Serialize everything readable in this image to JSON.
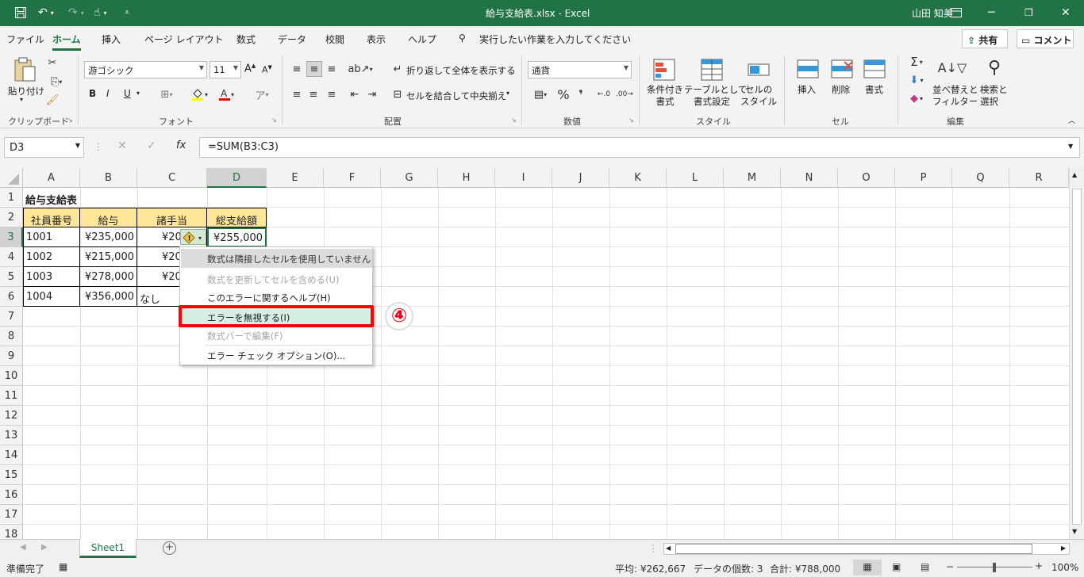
{
  "window": {
    "title": "給与支給表.xlsx  -  Excel",
    "user": "山田 知美"
  },
  "tabs": [
    "ファイル",
    "ホーム",
    "挿入",
    "ページ レイアウト",
    "数式",
    "データ",
    "校閲",
    "表示",
    "ヘルプ"
  ],
  "tell_me": "実行したい作業を入力してください",
  "share": "共有",
  "comment": "コメント",
  "ribbon": {
    "paste": "貼り付け",
    "font_name": "游ゴシック",
    "font_size": "11",
    "font_grow": "A",
    "font_shrink": "A",
    "bold": "B",
    "italic": "I",
    "underline": "U",
    "wrap_text": "折り返して全体を表示する",
    "merge_center": "セルを結合して中央揃え",
    "number_format": "通貨",
    "cond_format": [
      "条件付き",
      "書式"
    ],
    "table_format": [
      "テーブルとして",
      "書式設定"
    ],
    "cell_style": [
      "セルの",
      "スタイル"
    ],
    "insert": "挿入",
    "delete": "削除",
    "format": "書式",
    "sort_filter": [
      "並べ替えと",
      "フィルター"
    ],
    "find_select": [
      "検索と",
      "選択"
    ],
    "groups": {
      "clipboard": "クリップボード",
      "font": "フォント",
      "alignment": "配置",
      "number": "数値",
      "style": "スタイル",
      "cells": "セル",
      "editing": "編集"
    }
  },
  "formula": {
    "name_box": "D3",
    "formula": "=SUM(B3:C3)"
  },
  "columns": [
    "A",
    "B",
    "C",
    "D",
    "E",
    "F",
    "G",
    "H",
    "I",
    "J",
    "K",
    "L",
    "M",
    "N",
    "O",
    "P",
    "Q",
    "R"
  ],
  "rows": [
    "1",
    "2",
    "3",
    "4",
    "5",
    "6",
    "7",
    "8",
    "9",
    "10",
    "11",
    "12",
    "13",
    "14",
    "15",
    "16",
    "17",
    "18"
  ],
  "cells": {
    "title": "給与支給表",
    "headers": [
      "社員番号",
      "給与",
      "諸手当",
      "総支給額"
    ],
    "data": [
      [
        "1001",
        "¥235,000",
        "¥20",
        "¥255,000"
      ],
      [
        "1002",
        "¥215,000",
        "¥20",
        ""
      ],
      [
        "1003",
        "¥278,000",
        "¥20",
        ""
      ],
      [
        "1004",
        "¥356,000",
        "なし",
        ""
      ]
    ]
  },
  "context_menu": {
    "items": [
      "数式は隣接したセルを使用していません",
      "数式を更新してセルを含める(U)",
      "このエラーに関するヘルプ(H)",
      "エラーを無視する(I)",
      "数式バーで編集(F)",
      "エラー チェック オプション(O)..."
    ]
  },
  "step_marker": "④",
  "sheet_tab": "Sheet1",
  "status": {
    "ready": "準備完了",
    "average": "平均: ¥262,667",
    "count": "データの個数: 3",
    "sum": "合計: ¥788,000",
    "zoom": "100%"
  },
  "colors": {
    "excel_green": "#217346",
    "header_fill": "#ffe699",
    "highlight_red": "#ff0000",
    "ignore_item_bg": "#d6efe2"
  }
}
